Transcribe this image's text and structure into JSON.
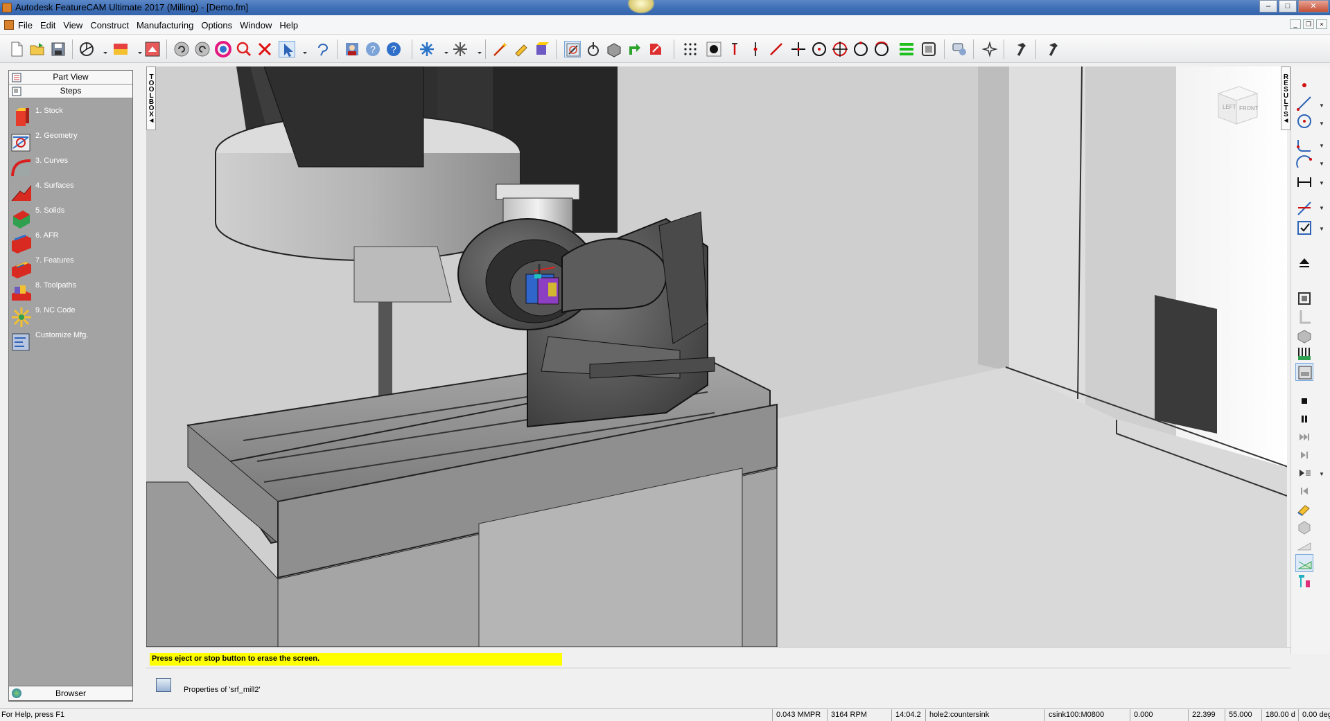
{
  "window": {
    "title": "Autodesk FeatureCAM Ultimate 2017 (Milling) - [Demo.fm]",
    "buttons": {
      "minimize": "–",
      "maximize": "□",
      "close": "✕"
    }
  },
  "menu": [
    "File",
    "Edit",
    "View",
    "Construct",
    "Manufacturing",
    "Options",
    "Window",
    "Help"
  ],
  "left_panel": {
    "part_view": "Part View",
    "steps": "Steps",
    "items": [
      {
        "label": "1.  Stock",
        "icon": "stock-icon"
      },
      {
        "label": "2.  Geometry",
        "icon": "geometry-icon"
      },
      {
        "label": "3.  Curves",
        "icon": "curves-icon"
      },
      {
        "label": "4.  Surfaces",
        "icon": "surfaces-icon"
      },
      {
        "label": "5.  Solids",
        "icon": "solids-icon"
      },
      {
        "label": "6.  AFR",
        "icon": "afr-icon"
      },
      {
        "label": "7.  Features",
        "icon": "features-icon"
      },
      {
        "label": "8.  Toolpaths",
        "icon": "toolpaths-icon"
      },
      {
        "label": "9.  NC Code",
        "icon": "nc-code-icon"
      },
      {
        "label": "Customize Mfg.",
        "icon": "customize-mfg-icon"
      }
    ],
    "browser": "Browser"
  },
  "toolbox_tab": "TOOLBOX◄",
  "results_tab": "RESULTS◄",
  "viewcube": {
    "left": "LEFT",
    "front": "FRONT"
  },
  "message": "Press eject or stop button to erase the screen.",
  "properties": "Properties of 'srf_mill2'",
  "status": {
    "help": "For Help, press F1",
    "feed": "0.043 MMPR",
    "speed": "3164 RPM",
    "time": "14:04.2",
    "operation": "hole2:countersink",
    "tool": "csink100:M0800",
    "x": "0.000",
    "y": "22.399",
    "z": "55.000",
    "a": "180.00 d",
    "b": "0.00 deg"
  },
  "colors": {
    "titlebar": "#3d6db4",
    "message_bg": "#ffff00",
    "panel_bg": "#a3a3a3",
    "viewport_bg": "#cfcfcf"
  }
}
